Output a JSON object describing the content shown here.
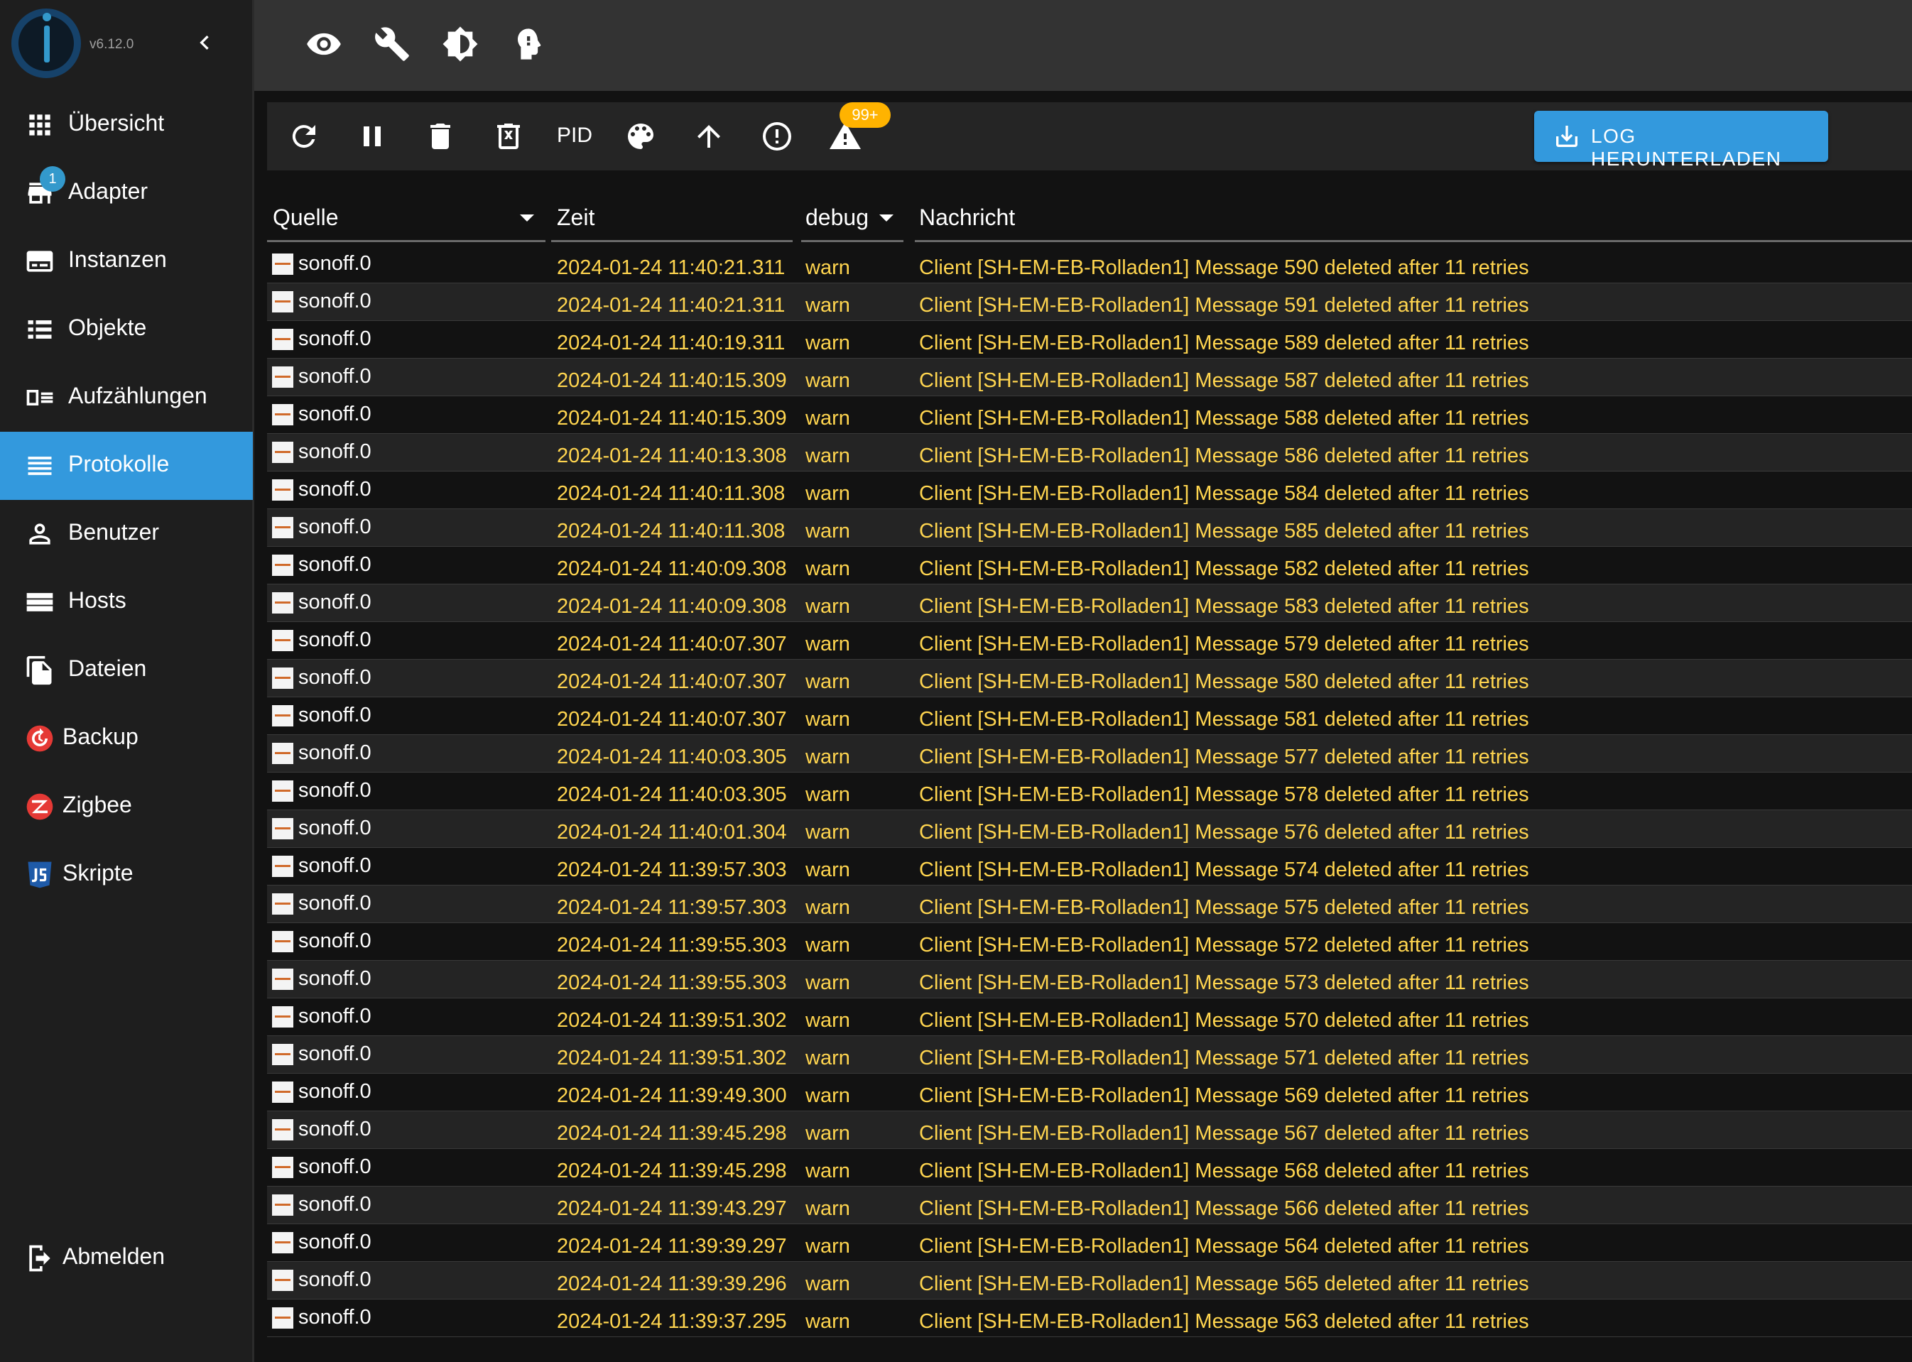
{
  "app": {
    "version": "v6.12.0"
  },
  "sidebar": {
    "items": [
      {
        "id": "uebersicht",
        "label": "Übersicht",
        "icon": "grid-icon"
      },
      {
        "id": "adapter",
        "label": "Adapter",
        "icon": "store-icon",
        "badge": "1"
      },
      {
        "id": "instanzen",
        "label": "Instanzen",
        "icon": "instances-icon"
      },
      {
        "id": "objekte",
        "label": "Objekte",
        "icon": "list-icon"
      },
      {
        "id": "aufzaehlungen",
        "label": "Aufzählungen",
        "icon": "enum-icon"
      },
      {
        "id": "protokolle",
        "label": "Protokolle",
        "icon": "log-icon",
        "active": true
      },
      {
        "id": "benutzer",
        "label": "Benutzer",
        "icon": "user-icon"
      },
      {
        "id": "hosts",
        "label": "Hosts",
        "icon": "hosts-icon"
      },
      {
        "id": "dateien",
        "label": "Dateien",
        "icon": "files-icon"
      },
      {
        "id": "backup",
        "label": "Backup",
        "icon": "backup-icon"
      },
      {
        "id": "zigbee",
        "label": "Zigbee",
        "icon": "zigbee-icon"
      },
      {
        "id": "skripte",
        "label": "Skripte",
        "icon": "js-icon"
      }
    ],
    "logout": {
      "label": "Abmelden",
      "icon": "logout-icon"
    }
  },
  "topbar": {
    "icons": [
      "eye-icon",
      "wrench-icon",
      "brightness-icon",
      "expert-mode-icon"
    ]
  },
  "toolbar": {
    "pid_label": "PID",
    "warn_badge": "99+",
    "download_label": "LOG HERUNTERLADEN"
  },
  "table": {
    "columns": {
      "source": "Quelle",
      "time": "Zeit",
      "severity": "debug",
      "message": "Nachricht"
    },
    "rows": [
      {
        "source": "sonoff.0",
        "time": "2024-01-24 11:40:21.311",
        "severity": "warn",
        "message": "Client [SH-EM-EB-Rolladen1] Message 590 deleted after 11 retries"
      },
      {
        "source": "sonoff.0",
        "time": "2024-01-24 11:40:21.311",
        "severity": "warn",
        "message": "Client [SH-EM-EB-Rolladen1] Message 591 deleted after 11 retries"
      },
      {
        "source": "sonoff.0",
        "time": "2024-01-24 11:40:19.311",
        "severity": "warn",
        "message": "Client [SH-EM-EB-Rolladen1] Message 589 deleted after 11 retries"
      },
      {
        "source": "sonoff.0",
        "time": "2024-01-24 11:40:15.309",
        "severity": "warn",
        "message": "Client [SH-EM-EB-Rolladen1] Message 587 deleted after 11 retries"
      },
      {
        "source": "sonoff.0",
        "time": "2024-01-24 11:40:15.309",
        "severity": "warn",
        "message": "Client [SH-EM-EB-Rolladen1] Message 588 deleted after 11 retries"
      },
      {
        "source": "sonoff.0",
        "time": "2024-01-24 11:40:13.308",
        "severity": "warn",
        "message": "Client [SH-EM-EB-Rolladen1] Message 586 deleted after 11 retries"
      },
      {
        "source": "sonoff.0",
        "time": "2024-01-24 11:40:11.308",
        "severity": "warn",
        "message": "Client [SH-EM-EB-Rolladen1] Message 584 deleted after 11 retries"
      },
      {
        "source": "sonoff.0",
        "time": "2024-01-24 11:40:11.308",
        "severity": "warn",
        "message": "Client [SH-EM-EB-Rolladen1] Message 585 deleted after 11 retries"
      },
      {
        "source": "sonoff.0",
        "time": "2024-01-24 11:40:09.308",
        "severity": "warn",
        "message": "Client [SH-EM-EB-Rolladen1] Message 582 deleted after 11 retries"
      },
      {
        "source": "sonoff.0",
        "time": "2024-01-24 11:40:09.308",
        "severity": "warn",
        "message": "Client [SH-EM-EB-Rolladen1] Message 583 deleted after 11 retries"
      },
      {
        "source": "sonoff.0",
        "time": "2024-01-24 11:40:07.307",
        "severity": "warn",
        "message": "Client [SH-EM-EB-Rolladen1] Message 579 deleted after 11 retries"
      },
      {
        "source": "sonoff.0",
        "time": "2024-01-24 11:40:07.307",
        "severity": "warn",
        "message": "Client [SH-EM-EB-Rolladen1] Message 580 deleted after 11 retries"
      },
      {
        "source": "sonoff.0",
        "time": "2024-01-24 11:40:07.307",
        "severity": "warn",
        "message": "Client [SH-EM-EB-Rolladen1] Message 581 deleted after 11 retries"
      },
      {
        "source": "sonoff.0",
        "time": "2024-01-24 11:40:03.305",
        "severity": "warn",
        "message": "Client [SH-EM-EB-Rolladen1] Message 577 deleted after 11 retries"
      },
      {
        "source": "sonoff.0",
        "time": "2024-01-24 11:40:03.305",
        "severity": "warn",
        "message": "Client [SH-EM-EB-Rolladen1] Message 578 deleted after 11 retries"
      },
      {
        "source": "sonoff.0",
        "time": "2024-01-24 11:40:01.304",
        "severity": "warn",
        "message": "Client [SH-EM-EB-Rolladen1] Message 576 deleted after 11 retries"
      },
      {
        "source": "sonoff.0",
        "time": "2024-01-24 11:39:57.303",
        "severity": "warn",
        "message": "Client [SH-EM-EB-Rolladen1] Message 574 deleted after 11 retries"
      },
      {
        "source": "sonoff.0",
        "time": "2024-01-24 11:39:57.303",
        "severity": "warn",
        "message": "Client [SH-EM-EB-Rolladen1] Message 575 deleted after 11 retries"
      },
      {
        "source": "sonoff.0",
        "time": "2024-01-24 11:39:55.303",
        "severity": "warn",
        "message": "Client [SH-EM-EB-Rolladen1] Message 572 deleted after 11 retries"
      },
      {
        "source": "sonoff.0",
        "time": "2024-01-24 11:39:55.303",
        "severity": "warn",
        "message": "Client [SH-EM-EB-Rolladen1] Message 573 deleted after 11 retries"
      },
      {
        "source": "sonoff.0",
        "time": "2024-01-24 11:39:51.302",
        "severity": "warn",
        "message": "Client [SH-EM-EB-Rolladen1] Message 570 deleted after 11 retries"
      },
      {
        "source": "sonoff.0",
        "time": "2024-01-24 11:39:51.302",
        "severity": "warn",
        "message": "Client [SH-EM-EB-Rolladen1] Message 571 deleted after 11 retries"
      },
      {
        "source": "sonoff.0",
        "time": "2024-01-24 11:39:49.300",
        "severity": "warn",
        "message": "Client [SH-EM-EB-Rolladen1] Message 569 deleted after 11 retries"
      },
      {
        "source": "sonoff.0",
        "time": "2024-01-24 11:39:45.298",
        "severity": "warn",
        "message": "Client [SH-EM-EB-Rolladen1] Message 567 deleted after 11 retries"
      },
      {
        "source": "sonoff.0",
        "time": "2024-01-24 11:39:45.298",
        "severity": "warn",
        "message": "Client [SH-EM-EB-Rolladen1] Message 568 deleted after 11 retries"
      },
      {
        "source": "sonoff.0",
        "time": "2024-01-24 11:39:43.297",
        "severity": "warn",
        "message": "Client [SH-EM-EB-Rolladen1] Message 566 deleted after 11 retries"
      },
      {
        "source": "sonoff.0",
        "time": "2024-01-24 11:39:39.297",
        "severity": "warn",
        "message": "Client [SH-EM-EB-Rolladen1] Message 564 deleted after 11 retries"
      },
      {
        "source": "sonoff.0",
        "time": "2024-01-24 11:39:39.296",
        "severity": "warn",
        "message": "Client [SH-EM-EB-Rolladen1] Message 565 deleted after 11 retries"
      },
      {
        "source": "sonoff.0",
        "time": "2024-01-24 11:39:37.295",
        "severity": "warn",
        "message": "Client [SH-EM-EB-Rolladen1] Message 563 deleted after 11 retries"
      }
    ]
  },
  "colors": {
    "accent": "#3399dd",
    "warn_text": "#ffd54f",
    "badge": "#ffb300"
  }
}
